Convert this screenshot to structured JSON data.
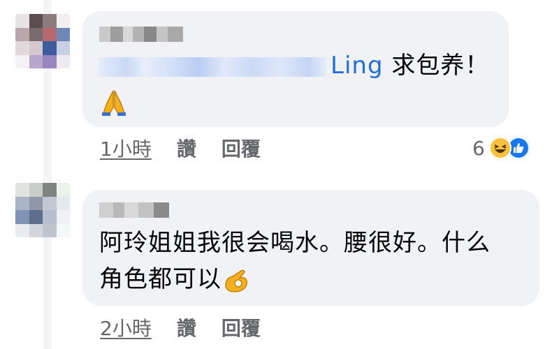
{
  "comments": [
    {
      "mention": "Ling",
      "text": "求包养！",
      "emoji_icon": "folded-hands-icon",
      "time": "1小時",
      "like_label": "讚",
      "reply_label": "回覆",
      "reaction_count": "6",
      "reaction_icons": [
        "haha-icon",
        "like-icon"
      ]
    },
    {
      "text_line1": "阿玲姐姐我很会喝水。腰很好。什么",
      "text_line2": "角色都可以",
      "emoji_icon": "ok-hand-icon",
      "time": "2小時",
      "like_label": "讚",
      "reply_label": "回覆"
    }
  ],
  "colors": {
    "bubble": "#f0f2f5",
    "mention": "#216fdb",
    "meta_text": "#65676b",
    "like_reaction": "#1877f2",
    "haha_reaction": "#f7c13a"
  }
}
